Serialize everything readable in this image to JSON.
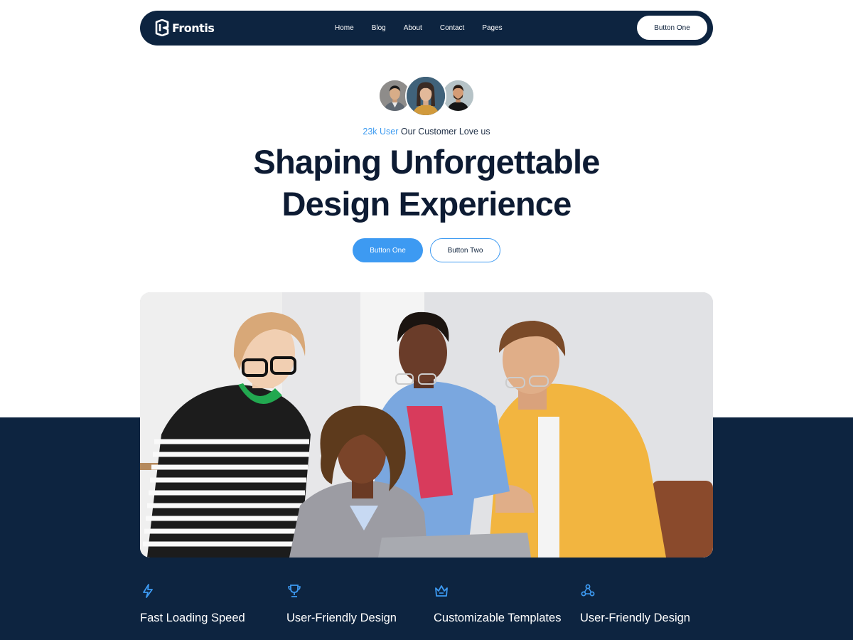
{
  "brand": {
    "name": "Frontis",
    "logo_icon": "frontis-logo-icon"
  },
  "nav": {
    "items": [
      "Home",
      "Blog",
      "About",
      "Contact",
      "Pages"
    ],
    "cta_label": "Button One"
  },
  "hero": {
    "user_count": "23k User",
    "tagline_rest": " Our Customer Love us",
    "headline_line1": "Shaping Unforgettable",
    "headline_line2": "Design Experience",
    "primary_button": "Button One",
    "secondary_button": "Button Two"
  },
  "features": [
    {
      "icon": "lightning-icon",
      "label": "Fast Loading Speed"
    },
    {
      "icon": "trophy-icon",
      "label": "User-Friendly Design"
    },
    {
      "icon": "crown-icon",
      "label": "Customizable Templates"
    },
    {
      "icon": "network-icon",
      "label": "User-Friendly Design"
    }
  ],
  "colors": {
    "navy": "#0d2440",
    "accent": "#3d9af2",
    "white": "#ffffff",
    "heading": "#0d1b33"
  }
}
